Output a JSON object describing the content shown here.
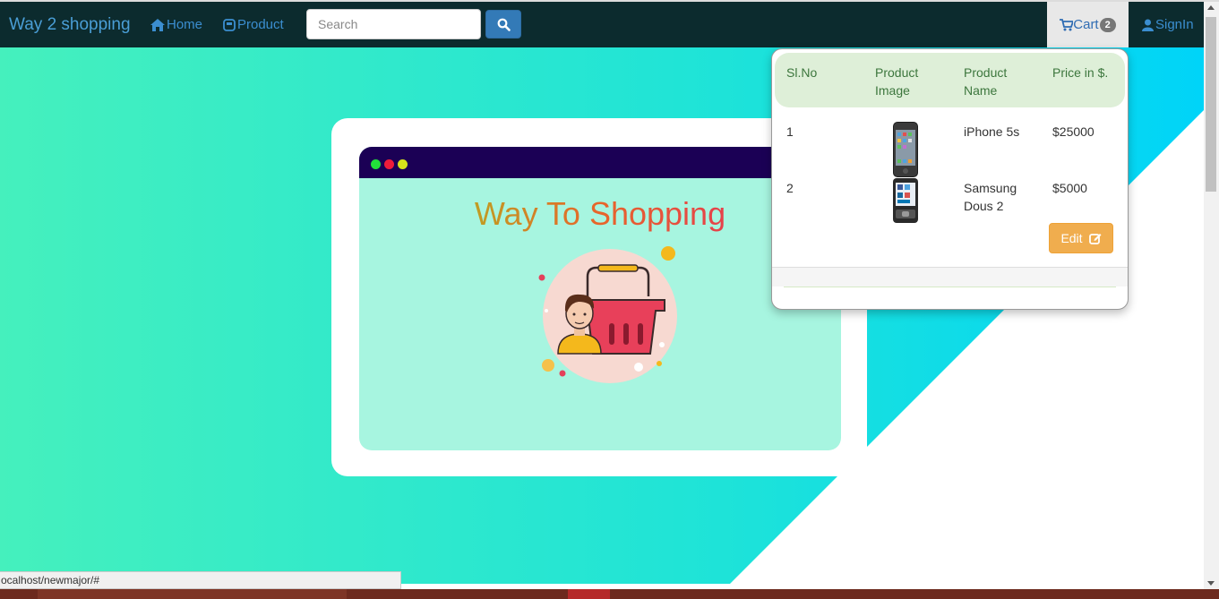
{
  "navbar": {
    "brand": "Way 2 shopping",
    "home_label": "Home",
    "product_label": "Product",
    "search_placeholder": "Search",
    "cart_label": "Cart",
    "cart_count": "2",
    "signin_label": "SignIn"
  },
  "hero": {
    "title": "Way To Shopping"
  },
  "cart": {
    "headers": {
      "slno": "Sl.No",
      "image_line1": "Product",
      "image_line2": "Image",
      "name_line1": "Product",
      "name_line2": "Name",
      "price": "Price in $."
    },
    "rows": [
      {
        "slno": "1",
        "name_line1": "iPhone 5s",
        "name_line2": "",
        "price": "$25000",
        "image_icon": "iphone-image"
      },
      {
        "slno": "2",
        "name_line1": "Samsung",
        "name_line2": "Dous 2",
        "price": "$5000",
        "image_icon": "samsung-phone-image"
      }
    ],
    "edit_label": "Edit"
  },
  "status_bar": {
    "url": "ocalhost/newmajor/#"
  },
  "colors": {
    "navbar_bg": "#0c2b2e",
    "link": "#3b8ed0",
    "hero_gradient_start": "#45f0bd",
    "hero_gradient_end": "#00d4f8",
    "window_bar": "#1b0055",
    "edit_button": "#f0ad4e",
    "table_header": "#deefd8"
  }
}
